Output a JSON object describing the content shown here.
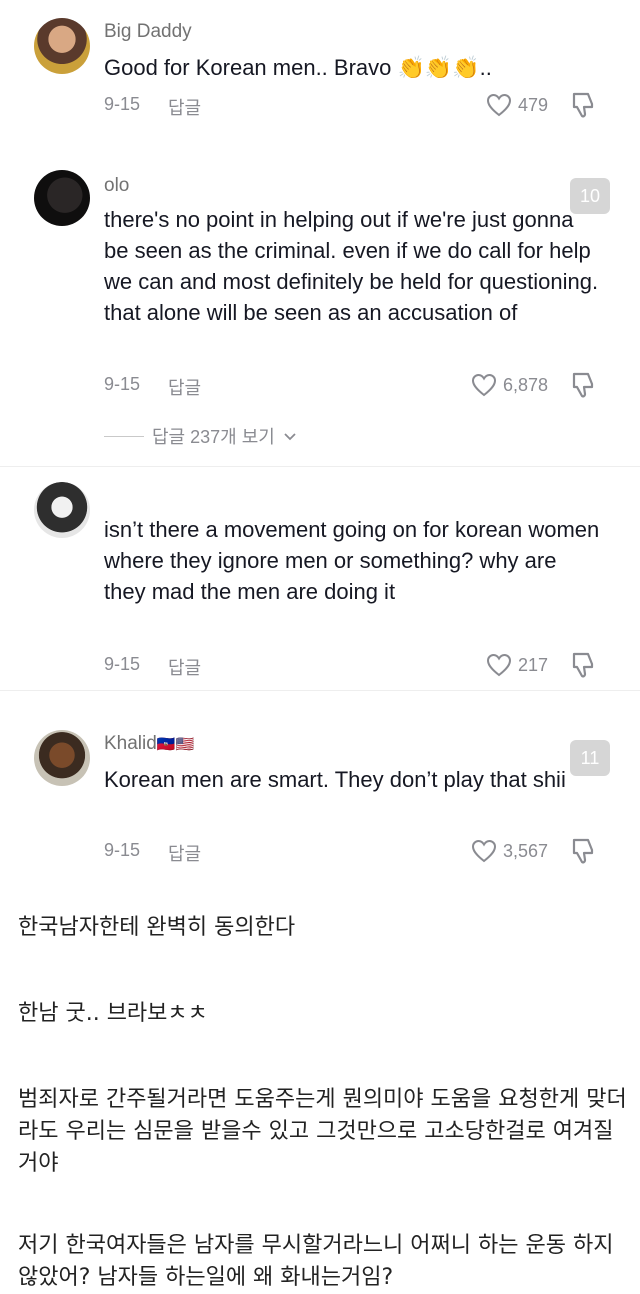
{
  "comments": [
    {
      "username": "Big Daddy",
      "text": "Good for Korean men.. Bravo ",
      "emoji": "👏👏👏..",
      "date": "9-15",
      "reply_label": "답글",
      "likes": "479"
    },
    {
      "username": "olo",
      "text": "there's no point in helping out if we're just gonna be seen as the criminal. even if we do call for help we can and most definitely be held for questioning. that alone will be seen as an accusation of",
      "date": "9-15",
      "reply_label": "답글",
      "likes": "6,878",
      "rank": "10",
      "view_replies": "답글 237개 보기"
    },
    {
      "username": "",
      "text": "isn’t there a movement going on for korean women where they ignore men or something? why are they mad the men are doing it",
      "date": "9-15",
      "reply_label": "답글",
      "likes": "217"
    },
    {
      "username": "Khalid",
      "flags": "🇭🇹🇺🇸",
      "text": "Korean men are smart. They don’t play that shii",
      "date": "9-15",
      "reply_label": "답글",
      "likes": "3,567",
      "rank": "11"
    }
  ],
  "translations": [
    "한국남자한테 완벽히 동의한다",
    "한남 굿.. 브라보ㅊㅊ",
    "범죄자로 간주될거라면 도움주는게 뭔의미야 도움을 요청한게 맞더라도 우리는 심문을 받을수 있고 그것만으로 고소당한걸로 여겨질거야",
    "저기 한국여자들은 남자를 무시할거라느니 어쩌니 하는 운동 하지않았어? 남자들 하는일에 왜 화내는거임?"
  ]
}
